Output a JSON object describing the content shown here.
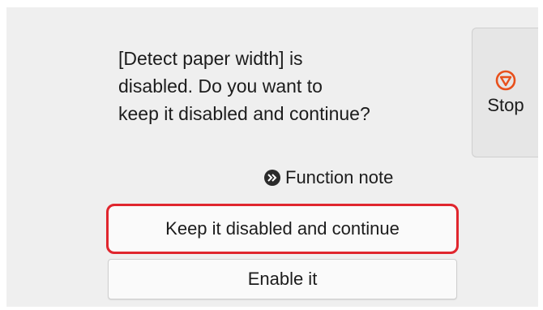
{
  "dialog": {
    "message": "[Detect paper width] is\ndisabled. Do you want to\nkeep it disabled and continue?"
  },
  "stop_button": {
    "label": "Stop",
    "icon": "stop-icon"
  },
  "function_note": {
    "label": "Function note",
    "icon": "double-chevron-right-icon"
  },
  "options": {
    "keep_label": "Keep it disabled and continue",
    "enable_label": "Enable it"
  },
  "colors": {
    "accent_stop": "#e8501c",
    "selection_border": "#e0262e",
    "background": "#efefef"
  }
}
